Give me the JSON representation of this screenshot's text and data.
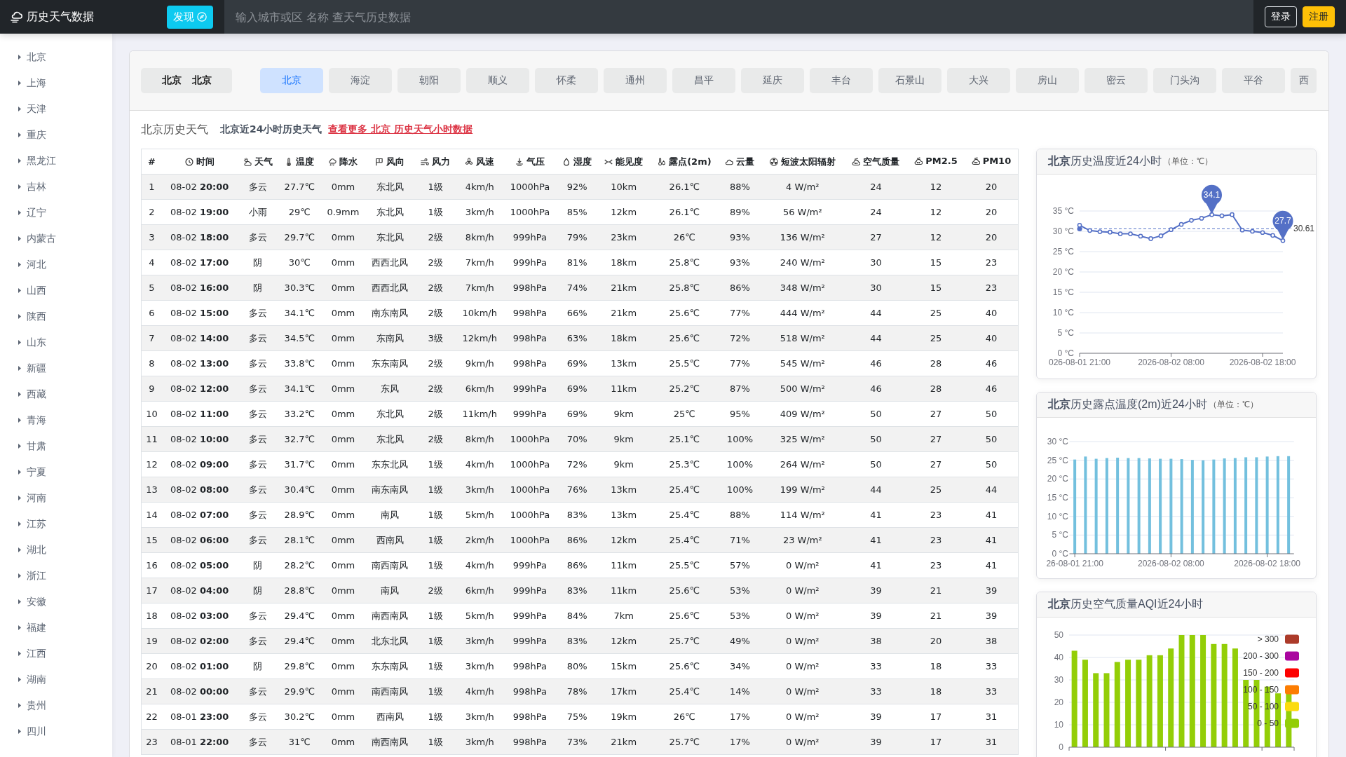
{
  "navbar": {
    "title": "历史天气数据",
    "discover": "发现",
    "search": {
      "placeholder": "输入城市或区 名称 查天气历史数据"
    },
    "buttons": [
      {
        "label": "登录",
        "kind": "outline"
      },
      {
        "label": "注册",
        "kind": "primary"
      }
    ]
  },
  "sidebar": {
    "items": [
      "北京",
      "上海",
      "天津",
      "重庆",
      "黑龙江",
      "吉林",
      "辽宁",
      "内蒙古",
      "河北",
      "山西",
      "陕西",
      "山东",
      "新疆",
      "西藏",
      "青海",
      "甘肃",
      "宁夏",
      "河南",
      "江苏",
      "湖北",
      "浙江",
      "安徽",
      "福建",
      "江西",
      "湖南",
      "贵州",
      "四川"
    ]
  },
  "location": {
    "province": "北京",
    "city": "北京"
  },
  "districts": [
    {
      "label": "北京",
      "selected": true
    },
    {
      "label": "海淀",
      "selected": false
    },
    {
      "label": "朝阳",
      "selected": false
    },
    {
      "label": "顺义",
      "selected": false
    },
    {
      "label": "怀柔",
      "selected": false
    },
    {
      "label": "通州",
      "selected": false
    },
    {
      "label": "昌平",
      "selected": false
    },
    {
      "label": "延庆",
      "selected": false
    },
    {
      "label": "丰台",
      "selected": false
    },
    {
      "label": "石景山",
      "selected": false
    },
    {
      "label": "大兴",
      "selected": false
    },
    {
      "label": "房山",
      "selected": false
    },
    {
      "label": "密云",
      "selected": false
    },
    {
      "label": "门头沟",
      "selected": false
    },
    {
      "label": "平谷",
      "selected": false
    },
    {
      "label": "西",
      "selected": false
    }
  ],
  "section": {
    "title": "北京历史天气",
    "subtitle": "北京近24小时历史天气",
    "link": "查看更多 北京 历史天气小时数据"
  },
  "table": {
    "columns": [
      "#",
      "时间",
      "天气",
      "温度",
      "降水",
      "风向",
      "风力",
      "风速",
      "气压",
      "湿度",
      "能见度",
      "露点(2m)",
      "云量",
      "短波太阳辐射",
      "空气质量",
      "PM2.5",
      "PM10"
    ],
    "rows": [
      [
        "1",
        "08-02 **20:00**",
        "多云",
        "27.7℃",
        "0mm",
        "东北风",
        "1级",
        "4km/h",
        "1000hPa",
        "92%",
        "10km",
        "26.1℃",
        "88%",
        "4 W/m²",
        "24",
        "12",
        "20"
      ],
      [
        "2",
        "08-02 **19:00**",
        "小雨",
        "29℃",
        "0.9mm",
        "东北风",
        "1级",
        "3km/h",
        "1000hPa",
        "85%",
        "12km",
        "26.1℃",
        "89%",
        "56 W/m²",
        "24",
        "12",
        "20"
      ],
      [
        "3",
        "08-02 **18:00**",
        "多云",
        "29.7℃",
        "0mm",
        "东北风",
        "2级",
        "8km/h",
        "999hPa",
        "79%",
        "23km",
        "26℃",
        "93%",
        "136 W/m²",
        "27",
        "12",
        "20"
      ],
      [
        "4",
        "08-02 **17:00**",
        "阴",
        "30℃",
        "0mm",
        "西西北风",
        "2级",
        "7km/h",
        "999hPa",
        "81%",
        "18km",
        "25.8℃",
        "93%",
        "240 W/m²",
        "30",
        "15",
        "23"
      ],
      [
        "5",
        "08-02 **16:00**",
        "阴",
        "30.3℃",
        "0mm",
        "西西北风",
        "2级",
        "7km/h",
        "998hPa",
        "74%",
        "21km",
        "25.8℃",
        "86%",
        "348 W/m²",
        "30",
        "15",
        "23"
      ],
      [
        "6",
        "08-02 **15:00**",
        "多云",
        "34.1℃",
        "0mm",
        "南东南风",
        "2级",
        "10km/h",
        "998hPa",
        "66%",
        "21km",
        "25.6℃",
        "77%",
        "444 W/m²",
        "44",
        "25",
        "40"
      ],
      [
        "7",
        "08-02 **14:00**",
        "多云",
        "34.5℃",
        "0mm",
        "东南风",
        "3级",
        "12km/h",
        "998hPa",
        "63%",
        "18km",
        "25.6℃",
        "72%",
        "518 W/m²",
        "44",
        "25",
        "40"
      ],
      [
        "8",
        "08-02 **13:00**",
        "多云",
        "33.8℃",
        "0mm",
        "东东南风",
        "2级",
        "9km/h",
        "998hPa",
        "69%",
        "13km",
        "25.5℃",
        "77%",
        "545 W/m²",
        "46",
        "28",
        "46"
      ],
      [
        "9",
        "08-02 **12:00**",
        "多云",
        "34.1℃",
        "0mm",
        "东风",
        "2级",
        "6km/h",
        "999hPa",
        "69%",
        "11km",
        "25.2℃",
        "87%",
        "500 W/m²",
        "46",
        "28",
        "46"
      ],
      [
        "10",
        "08-02 **11:00**",
        "多云",
        "33.2℃",
        "0mm",
        "东北风",
        "2级",
        "11km/h",
        "999hPa",
        "69%",
        "9km",
        "25℃",
        "95%",
        "409 W/m²",
        "50",
        "27",
        "50"
      ],
      [
        "11",
        "08-02 **10:00**",
        "多云",
        "32.7℃",
        "0mm",
        "东北风",
        "2级",
        "8km/h",
        "1000hPa",
        "70%",
        "9km",
        "25.1℃",
        "100%",
        "325 W/m²",
        "50",
        "27",
        "50"
      ],
      [
        "12",
        "08-02 **09:00**",
        "多云",
        "31.7℃",
        "0mm",
        "东东北风",
        "1级",
        "4km/h",
        "1000hPa",
        "72%",
        "9km",
        "25.3℃",
        "100%",
        "264 W/m²",
        "50",
        "27",
        "50"
      ],
      [
        "13",
        "08-02 **08:00**",
        "多云",
        "30.4℃",
        "0mm",
        "南东南风",
        "1级",
        "3km/h",
        "1000hPa",
        "76%",
        "13km",
        "25.4℃",
        "100%",
        "199 W/m²",
        "44",
        "25",
        "44"
      ],
      [
        "14",
        "08-02 **07:00**",
        "多云",
        "28.9℃",
        "0mm",
        "南风",
        "1级",
        "5km/h",
        "1000hPa",
        "83%",
        "13km",
        "25.4℃",
        "88%",
        "114 W/m²",
        "41",
        "23",
        "41"
      ],
      [
        "15",
        "08-02 **06:00**",
        "多云",
        "28.1℃",
        "0mm",
        "西南风",
        "1级",
        "2km/h",
        "1000hPa",
        "86%",
        "12km",
        "25.4℃",
        "71%",
        "23 W/m²",
        "41",
        "23",
        "41"
      ],
      [
        "16",
        "08-02 **05:00**",
        "阴",
        "28.2℃",
        "0mm",
        "南西南风",
        "1级",
        "4km/h",
        "999hPa",
        "86%",
        "11km",
        "25.5℃",
        "57%",
        "0 W/m²",
        "41",
        "23",
        "41"
      ],
      [
        "17",
        "08-02 **04:00**",
        "阴",
        "28.8℃",
        "0mm",
        "南风",
        "2级",
        "6km/h",
        "999hPa",
        "83%",
        "11km",
        "25.6℃",
        "53%",
        "0 W/m²",
        "39",
        "21",
        "39"
      ],
      [
        "18",
        "08-02 **03:00**",
        "多云",
        "29.4℃",
        "0mm",
        "南西南风",
        "1级",
        "5km/h",
        "999hPa",
        "84%",
        "7km",
        "25.6℃",
        "53%",
        "0 W/m²",
        "39",
        "21",
        "39"
      ],
      [
        "19",
        "08-02 **02:00**",
        "多云",
        "29.4℃",
        "0mm",
        "北东北风",
        "1级",
        "3km/h",
        "999hPa",
        "83%",
        "12km",
        "25.7℃",
        "49%",
        "0 W/m²",
        "38",
        "20",
        "38"
      ],
      [
        "20",
        "08-02 **01:00**",
        "阴",
        "29.8℃",
        "0mm",
        "东东南风",
        "1级",
        "3km/h",
        "998hPa",
        "80%",
        "15km",
        "25.6℃",
        "34%",
        "0 W/m²",
        "33",
        "18",
        "33"
      ],
      [
        "21",
        "08-02 **00:00**",
        "多云",
        "29.9℃",
        "0mm",
        "南西南风",
        "1级",
        "4km/h",
        "998hPa",
        "78%",
        "17km",
        "25.4℃",
        "14%",
        "0 W/m²",
        "33",
        "18",
        "33"
      ],
      [
        "22",
        "08-01 **23:00**",
        "多云",
        "30.2℃",
        "0mm",
        "西南风",
        "1级",
        "3km/h",
        "998hPa",
        "75%",
        "19km",
        "26℃",
        "17%",
        "0 W/m²",
        "39",
        "17",
        "31"
      ],
      [
        "23",
        "08-01 **22:00**",
        "多云",
        "31℃",
        "0mm",
        "南西南风",
        "1级",
        "3km/h",
        "998hPa",
        "73%",
        "21km",
        "25.7℃",
        "17%",
        "0 W/m²",
        "39",
        "17",
        "31"
      ]
    ]
  },
  "charts": [
    {
      "title": "**北京**历史温度近24小时",
      "unit": "（单位：℃）",
      "chart_data": {
        "type": "line",
        "categories": [
          "026-08-01 21:00",
          null,
          null,
          null,
          null,
          null,
          null,
          null,
          null,
          "2026-08-02 08:00",
          null,
          null,
          null,
          null,
          null,
          null,
          null,
          null,
          "2026-08-02 18:00",
          null,
          null
        ],
        "series": [
          {
            "color": "#5470c6",
            "marker": "circle",
            "values": [
              31.5,
              30.2,
              29.9,
              29.8,
              29.4,
              29.4,
              28.8,
              28.2,
              28.9,
              30.4,
              31.7,
              32.7,
              33.2,
              34.1,
              33.8,
              34.1,
              30.3,
              30,
              29.7,
              29,
              27.7
            ]
          }
        ],
        "ylim": [
          0,
          35
        ],
        "yticks": [
          {
            "value": 0,
            "label": "0 °C"
          },
          {
            "value": 5,
            "label": "5 °C"
          },
          {
            "value": 10,
            "label": "10 °C"
          },
          {
            "value": 15,
            "label": "15 °C"
          },
          {
            "value": 20,
            "label": "20 °C"
          },
          {
            "value": 25,
            "label": "25 °C"
          },
          {
            "value": 30,
            "label": "30 °C"
          },
          {
            "value": 35,
            "label": "35 °C"
          }
        ],
        "grid": true,
        "ref_lines": [
          {
            "axis": "y",
            "value": 30.61,
            "label": "30.61"
          }
        ],
        "annotations": [
          {
            "y": 34.1,
            "text": "34.1"
          },
          {
            "y": 27.7,
            "text": "27.7"
          }
        ]
      }
    },
    {
      "title": "**北京**历史露点温度(2m)近24小时",
      "unit": "（单位：℃）",
      "chart_data": {
        "type": "bar",
        "categories": [
          "26-08-01 21:00",
          null,
          null,
          null,
          null,
          null,
          null,
          null,
          null,
          "2026-08-02 08:00",
          null,
          null,
          null,
          null,
          null,
          null,
          null,
          null,
          "2026-08-02 18:00",
          null,
          null
        ],
        "series": [
          {
            "color": "#73c0de",
            "values": [
              25.2,
              26,
              25.4,
              25.6,
              25.7,
              25.6,
              25.6,
              25.5,
              25.4,
              25.4,
              25.3,
              25.1,
              25,
              25.2,
              25.5,
              25.6,
              25.8,
              25.8,
              26,
              26.1,
              26.1
            ]
          }
        ],
        "ylim": [
          0,
          30
        ],
        "yticks": [
          {
            "value": 0,
            "label": "0 °C"
          },
          {
            "value": 5,
            "label": "5 °C"
          },
          {
            "value": 10,
            "label": "10 °C"
          },
          {
            "value": 15,
            "label": "15 °C"
          },
          {
            "value": 20,
            "label": "20 °C"
          },
          {
            "value": 25,
            "label": "25 °C"
          },
          {
            "value": 30,
            "label": "30 °C"
          }
        ],
        "grid": true
      }
    },
    {
      "title": "**北京**历史空气质量AQI近24小时",
      "legend": [
        {
          "label": "> 300",
          "color": "#ac3b2a"
        },
        {
          "label": "200 - 300",
          "color": "#aa069f"
        },
        {
          "label": "150 - 200",
          "color": "#fd0100"
        },
        {
          "label": "100 - 150",
          "color": "#fc7d02"
        },
        {
          "label": "50 - 100",
          "color": "#fbdb0f"
        },
        {
          "label": "0 - 50",
          "color": "#93ce07"
        }
      ],
      "chart_data": {
        "type": "bar",
        "series": [
          {
            "color": "#93ce07",
            "values": [
              43,
              39,
              33,
              33,
              38,
              39,
              39,
              41,
              41,
              44,
              50,
              50,
              50,
              46,
              46,
              44,
              30,
              30,
              27,
              24,
              24
            ]
          }
        ],
        "ylim": [
          0,
          50
        ],
        "yticks": [
          0,
          10,
          20,
          30,
          40,
          50
        ],
        "grid": true
      }
    }
  ]
}
